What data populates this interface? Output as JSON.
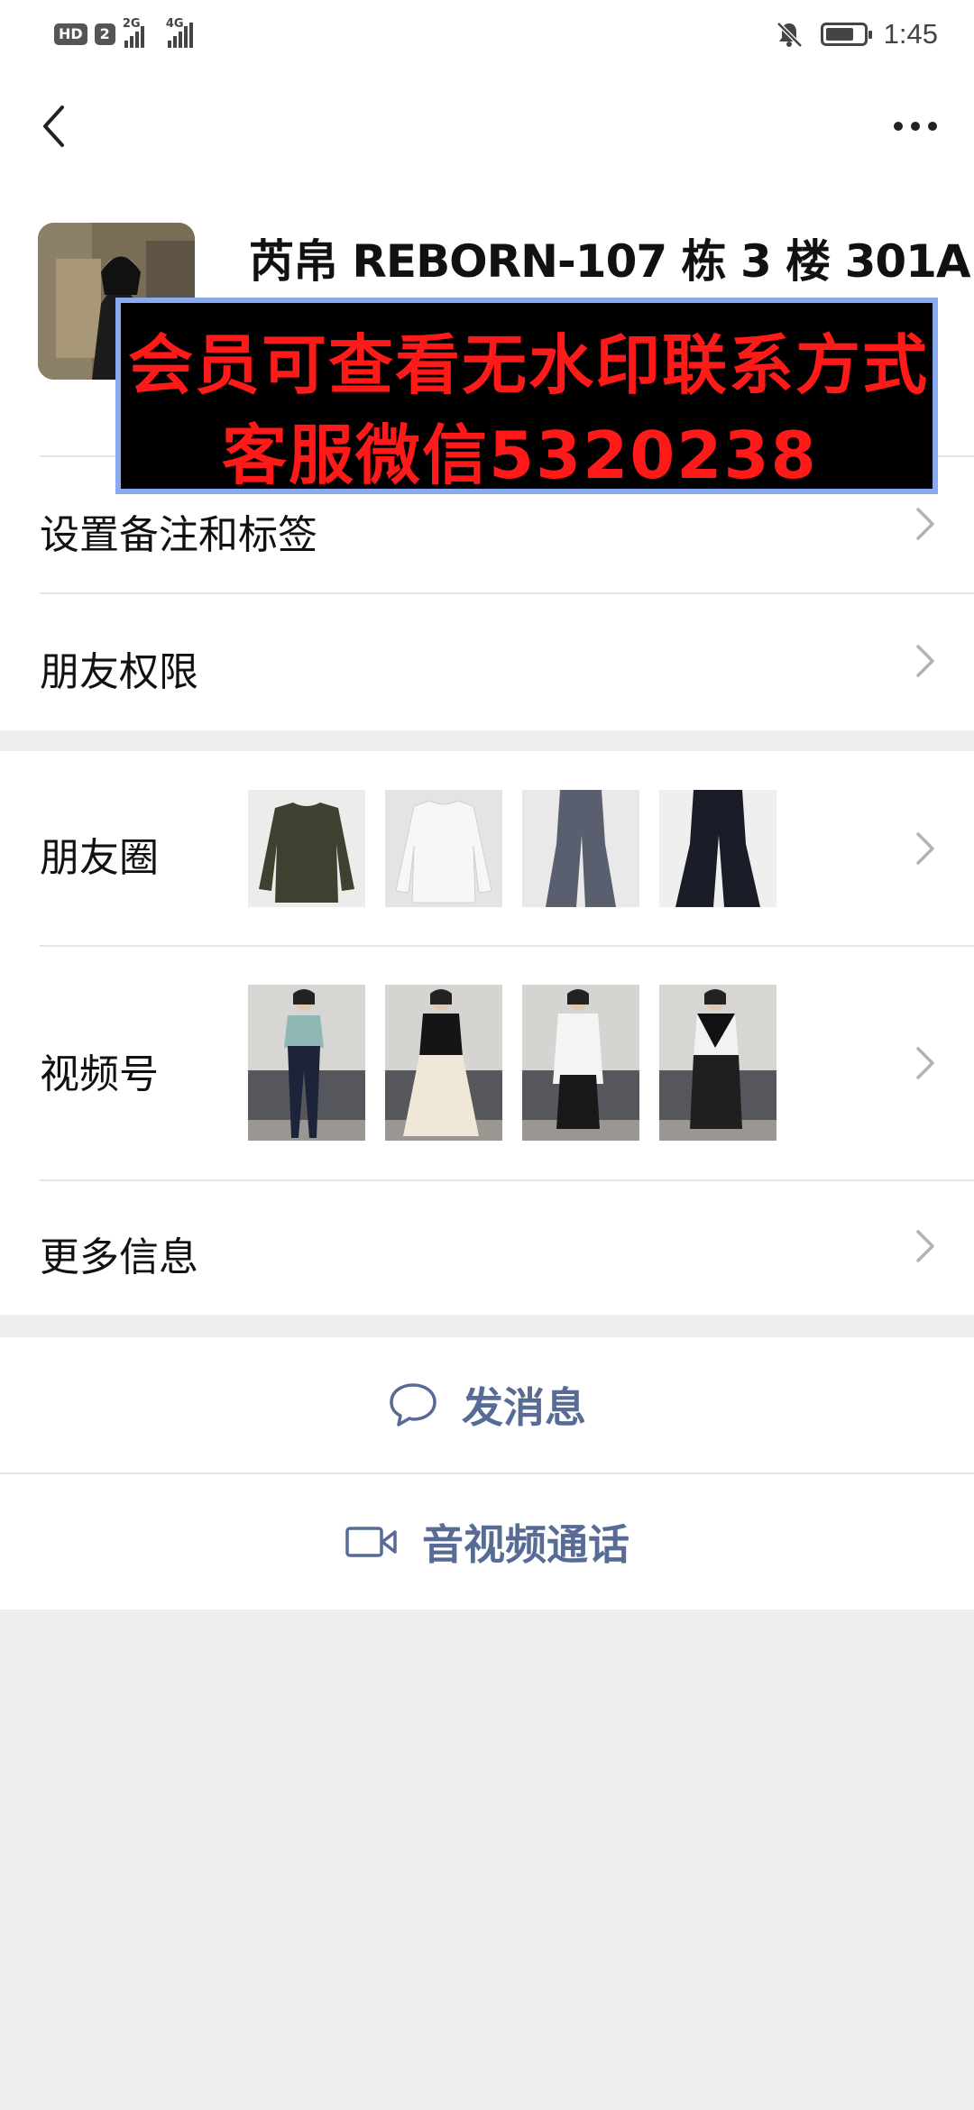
{
  "status_bar": {
    "hd": "HD",
    "sim": "2",
    "net1": "2G",
    "net2": "4G",
    "battery_level": 0.75,
    "time": "1:45"
  },
  "profile": {
    "name": "芮帛 REBORN-107 栋 3 楼 301A"
  },
  "watermark": {
    "line1": "会员可查看无水印联系方式",
    "line2": "客服微信5320238"
  },
  "menu": {
    "remark": "设置备注和标签",
    "permission": "朋友权限",
    "moments": "朋友圈",
    "channels": "视频号",
    "more_info": "更多信息"
  },
  "actions": {
    "message": "发消息",
    "call": "音视频通话"
  },
  "colors": {
    "link_blue": "#576b95",
    "watermark_red": "#ff1a1a"
  }
}
